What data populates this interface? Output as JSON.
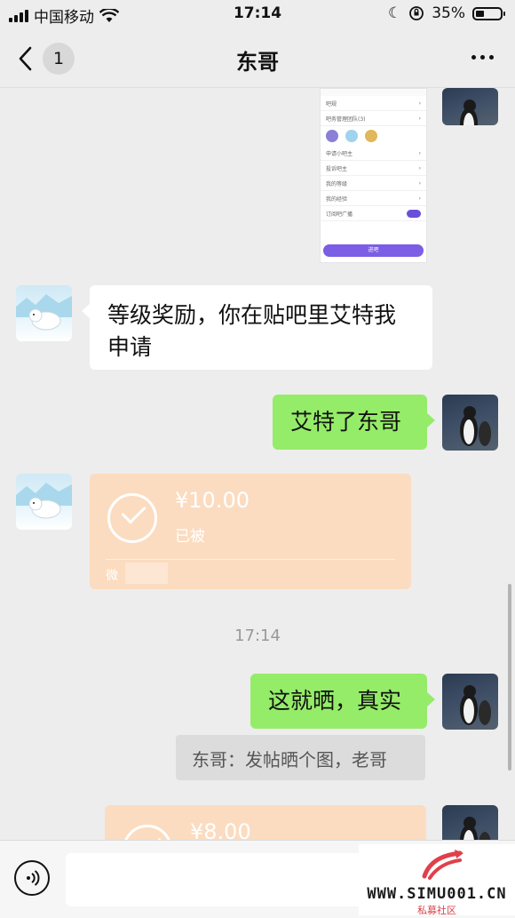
{
  "status_bar": {
    "carrier": "中国移动",
    "time": "17:14",
    "battery": "35%"
  },
  "nav": {
    "unread_count": "1",
    "title": "东哥"
  },
  "image_message": {
    "rows": [
      "吧规",
      "吧务管理团队(3)",
      "申请小吧主",
      "投诉吧主",
      "我的等级",
      "我的经验",
      "订阅吧广播"
    ],
    "button": "进吧"
  },
  "messages": [
    {
      "side": "in",
      "text": "等级奖励，你在贴吧里艾特我申请"
    },
    {
      "side": "out",
      "text": "艾特了东哥"
    },
    {
      "side": "out",
      "text": "这就晒，真实"
    }
  ],
  "transfer_1": {
    "amount": "¥10.00",
    "status": "已被"
  },
  "transfer_2": {
    "amount": "¥8.00"
  },
  "timestamp": "17:14",
  "quote": "东哥：发帖晒个图，老哥",
  "input": {
    "placeholder": ""
  },
  "watermark": {
    "url": "WWW.SIMU001.CN",
    "subtitle": "私募社区"
  },
  "colors": {
    "outgoing": "#95ec69",
    "incoming": "#ffffff",
    "transfer": "#fbdcc0",
    "background": "#ededed"
  }
}
